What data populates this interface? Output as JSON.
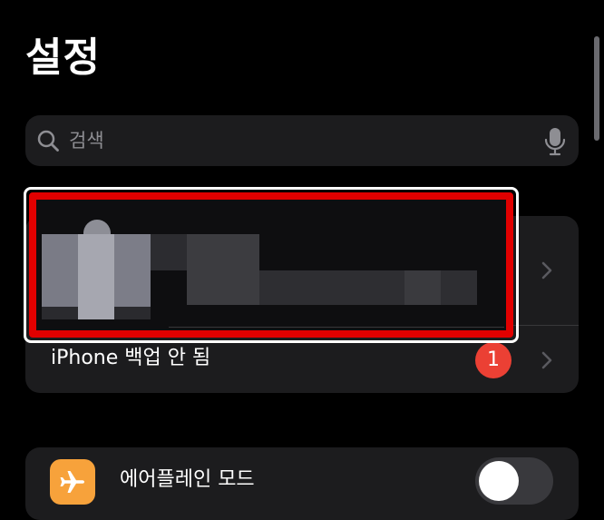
{
  "header": {
    "title": "설정"
  },
  "search": {
    "placeholder": "검색",
    "search_icon": "search-icon",
    "mic_icon": "microphone-icon"
  },
  "account": {
    "backup_label": "iPhone 백업 안 됨",
    "badge_count": "1"
  },
  "settings": {
    "airplane_label": "에어플레인 모드",
    "airplane_icon": "airplane-icon",
    "airplane_enabled": false
  },
  "colors": {
    "background": "#000000",
    "group_background": "#1c1c1e",
    "secondary_text": "#8e8e93",
    "badge": "#eb4034",
    "airplane_tile": "#f7a23b",
    "highlight_outer": "#ffffff",
    "highlight_inner": "#e10000"
  }
}
